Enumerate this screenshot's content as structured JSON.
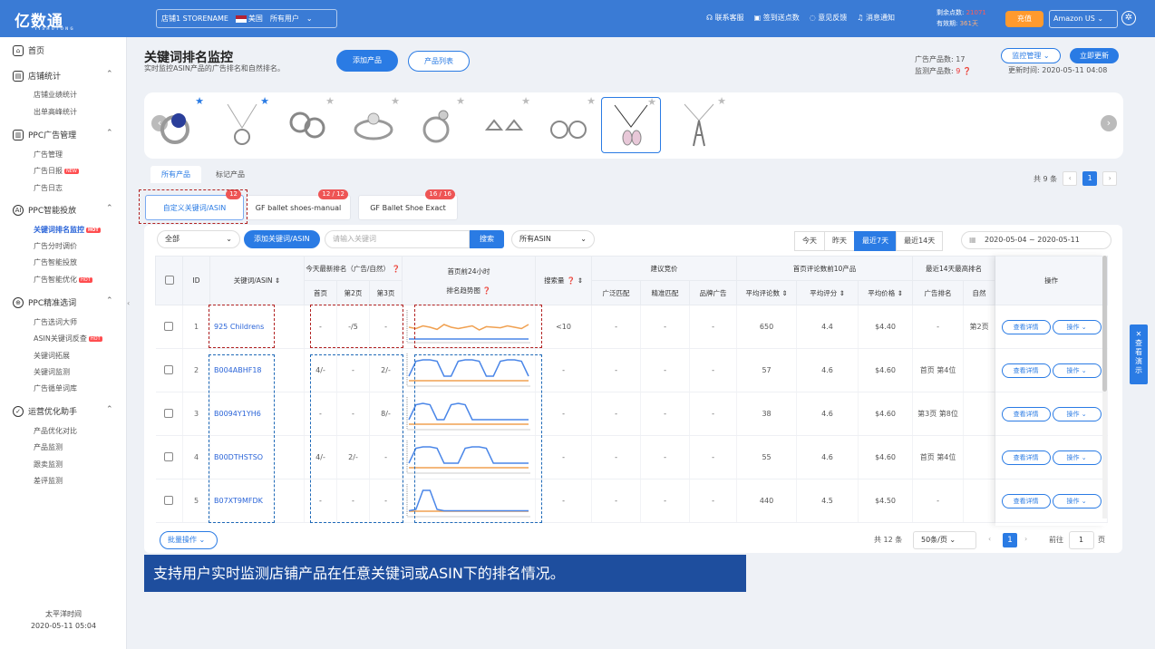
{
  "topbar": {
    "logo": "亿数通",
    "logo_sub": "YISHUTONG",
    "store_name": "店铺1 STORENAME",
    "country": "美国",
    "user_filter": "所有用户",
    "nav": [
      "联系客服",
      "签到送点数",
      "意见反馈",
      "消息通知"
    ],
    "points_label": "剩余点数:",
    "points_value": "21071",
    "expire_label": "有效期:",
    "expire_value": "361天",
    "recharge": "充值",
    "marketplace": "Amazon US"
  },
  "sidebar": {
    "home": "首页",
    "groups": [
      {
        "label": "店铺统计",
        "items": [
          "店铺业绩统计",
          "出单高峰统计"
        ]
      },
      {
        "label": "PPC广告管理",
        "items": [
          "广告管理",
          "广告日报",
          "广告日志"
        ]
      },
      {
        "label": "PPC智能投放",
        "items": [
          "关键词排名监控",
          "广告分时调价",
          "广告智能投放",
          "广告智能优化"
        ]
      },
      {
        "label": "PPC精准选词",
        "items": [
          "广告选词大师",
          "ASIN关键词反查",
          "关键词拓展",
          "关键词监测",
          "广告循单词库"
        ]
      },
      {
        "label": "运营优化助手",
        "items": [
          "产品优化对比",
          "产品监测",
          "跟卖监测",
          "差评监测"
        ]
      }
    ],
    "new_tag": "NEW",
    "hot_tag": "HOT",
    "timezone_label": "太平洋时间",
    "timezone_time": "2020-05-11 05:04"
  },
  "header": {
    "title": "关键词排名监控",
    "subtitle": "实时监控ASIN产品的广告排名和自然排名。",
    "add_product": "添加产品",
    "product_list": "产品列表",
    "ad_products_label": "广告产品数:",
    "ad_products_value": "17",
    "monitor_products_label": "监测产品数:",
    "monitor_products_value": "9",
    "monitor_manage": "监控管理",
    "update_now": "立即更新",
    "update_time_label": "更新时间:",
    "update_time": "2020-05-11 04:08"
  },
  "tabs": [
    "所有产品",
    "标记产品"
  ],
  "pager_top": {
    "total": "共 9 条",
    "page": "1"
  },
  "keyword_tabs": [
    {
      "label": "自定义关键词/ASIN",
      "badge": "12"
    },
    {
      "label": "GF ballet shoes-manual",
      "badge": "12 / 12"
    },
    {
      "label": "GF Ballet Shoe Exact",
      "badge": "16 / 16"
    }
  ],
  "toolbar": {
    "filter_all": "全部",
    "add_keyword": "添加关键词/ASIN",
    "keyword_placeholder": "请输入关键词",
    "search": "搜索",
    "asin_filter": "所有ASIN",
    "date_buttons": [
      "今天",
      "昨天",
      "最近7天",
      "最近14天"
    ],
    "date_start": "2020-05-04",
    "date_sep": "~",
    "date_end": "2020-05-11"
  },
  "table": {
    "h_id": "ID",
    "h_kw": "关键词/ASIN",
    "h_rank_today": "今天最新排名（广告/自然）",
    "h_page1": "首页",
    "h_page2": "第2页",
    "h_page3": "第3页",
    "h_trend_a": "首页前24小时",
    "h_trend_b": "排名趋势图",
    "h_search_vol": "搜索量",
    "h_bid": "建议竞价",
    "h_bid_broad": "广泛匹配",
    "h_bid_exact": "精准匹配",
    "h_bid_brand": "品牌广告",
    "h_top10": "首页评论数前10产品",
    "h_avg_reviews": "平均评论数",
    "h_avg_score": "平均评分",
    "h_avg_price": "平均价格",
    "h_recent14": "最近14天最高排名",
    "h_ad_rank": "广告排名",
    "h_nat_rank": "自然",
    "h_ops": "操作",
    "detail": "查看详情",
    "operate": "操作",
    "rows": [
      {
        "id": "1",
        "kw": "925 Childrens",
        "p1": "-",
        "p2": "-/5",
        "p3": "-",
        "vol": "<10",
        "broad": "-",
        "exact": "-",
        "brand": "-",
        "reviews": "650",
        "score": "4.4",
        "price": "$4.40",
        "ad": "-",
        "nat": "第2页",
        "spark": [
          [
            0.5,
            0.45,
            0.55,
            0.5,
            0.42,
            0.6,
            0.5,
            0.45,
            0.5,
            0.55,
            0.4,
            0.52,
            0.5,
            0.48,
            0.55,
            0.5,
            0.45,
            0.6
          ]
        ]
      },
      {
        "id": "2",
        "kw": "B004ABHF18",
        "p1": "4/-",
        "p2": "-",
        "p3": "2/-",
        "vol": "-",
        "broad": "-",
        "exact": "-",
        "brand": "-",
        "reviews": "57",
        "score": "4.6",
        "price": "$4.60",
        "ad": "首页 第4位",
        "nat": "",
        "spark": [
          [
            0.3,
            0.85,
            0.9,
            0.9,
            0.85,
            0.3,
            0.3,
            0.85,
            0.9,
            0.9,
            0.85,
            0.3,
            0.3,
            0.85,
            0.9,
            0.9,
            0.85,
            0.3
          ]
        ]
      },
      {
        "id": "3",
        "kw": "B0094Y1YH6",
        "p1": "-",
        "p2": "-",
        "p3": "8/-",
        "vol": "-",
        "broad": "-",
        "exact": "-",
        "brand": "-",
        "reviews": "38",
        "score": "4.6",
        "price": "$4.60",
        "ad": "第3页 第8位",
        "nat": "",
        "spark": [
          [
            0.3,
            0.85,
            0.9,
            0.85,
            0.3,
            0.3,
            0.85,
            0.9,
            0.85,
            0.3,
            0.3,
            0.3,
            0.3,
            0.3,
            0.3,
            0.3,
            0.3,
            0.3
          ]
        ]
      },
      {
        "id": "4",
        "kw": "B00DTHSTSO",
        "p1": "4/-",
        "p2": "2/-",
        "p3": "-",
        "vol": "-",
        "broad": "-",
        "exact": "-",
        "brand": "-",
        "reviews": "55",
        "score": "4.6",
        "price": "$4.60",
        "ad": "首页 第4位",
        "nat": "",
        "spark": [
          [
            0.3,
            0.85,
            0.9,
            0.9,
            0.85,
            0.3,
            0.3,
            0.3,
            0.85,
            0.9,
            0.9,
            0.85,
            0.3,
            0.3,
            0.3,
            0.3,
            0.3,
            0.3
          ]
        ]
      },
      {
        "id": "5",
        "kw": "B07XT9MFDK",
        "p1": "-",
        "p2": "-",
        "p3": "-",
        "vol": "-",
        "broad": "-",
        "exact": "-",
        "brand": "-",
        "reviews": "440",
        "score": "4.5",
        "price": "$4.50",
        "ad": "-",
        "nat": "",
        "spark": [
          [
            0.15,
            0.2,
            0.9,
            0.9,
            0.2,
            0.15,
            0.15,
            0.15,
            0.15,
            0.15,
            0.15,
            0.15,
            0.15,
            0.15,
            0.15,
            0.15,
            0.15,
            0.15
          ]
        ]
      }
    ]
  },
  "footer": {
    "batch": "批量操作",
    "total": "共 12 条",
    "page_size": "50条/页",
    "page": "1",
    "goto_label": "前往",
    "goto_value": "1",
    "goto_unit": "页"
  },
  "caption": "支持用户实时监测店铺产品在任意关键词或ASIN下的排名情况。",
  "demo_tab": "查看演示",
  "colors": {
    "accent": "#2a7be4",
    "topbar": "#3a7bd5",
    "caption": "#1e4e9e",
    "trend_blue": "#4a86e8",
    "trend_orange": "#f0a050"
  }
}
